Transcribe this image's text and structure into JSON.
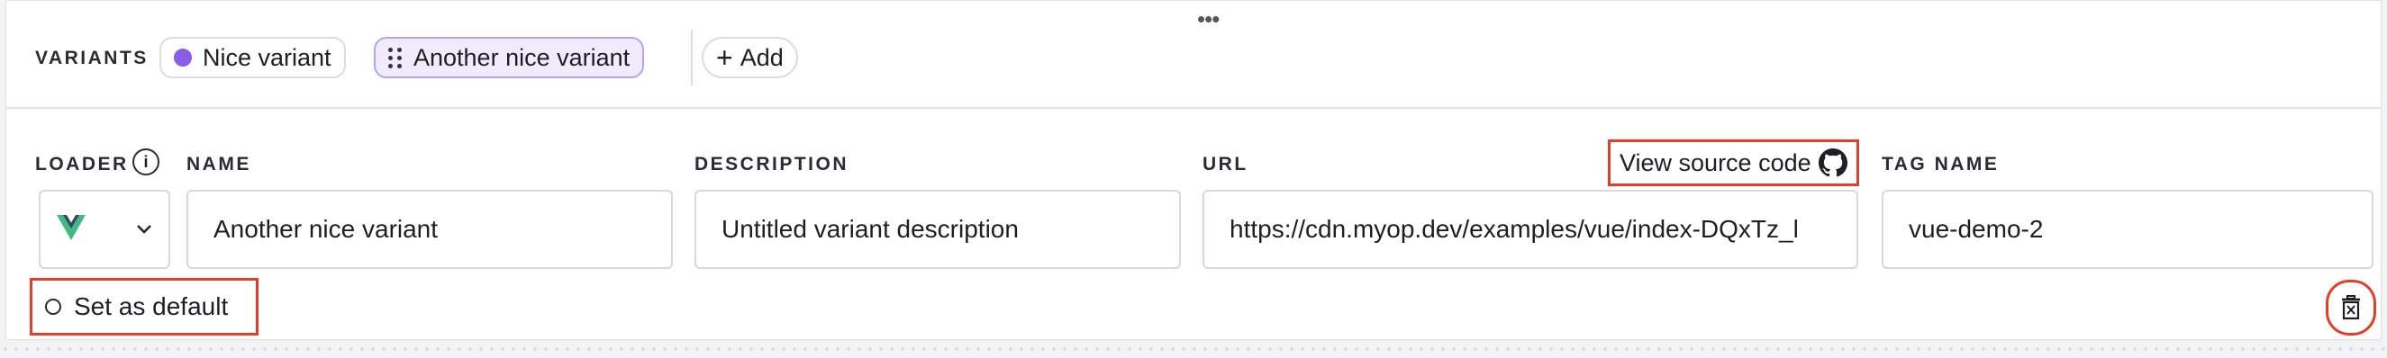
{
  "variants": {
    "label": "VARIANTS",
    "chips": [
      {
        "label": "Nice variant",
        "color": "#8a5de6"
      },
      {
        "label": "Another nice variant",
        "active": true
      }
    ],
    "add_label": "Add"
  },
  "form": {
    "loader_label": "LOADER",
    "name_label": "NAME",
    "description_label": "DESCRIPTION",
    "url_label": "URL",
    "tag_label": "TAG NAME",
    "name_value": "Another nice variant",
    "description_value": "Untitled variant description",
    "url_value": "https://cdn.myop.dev/examples/vue/index-DQxTz_l",
    "tag_value": "vue-demo-2",
    "view_source_label": "View source code",
    "set_default_label": "Set as default"
  },
  "icons": {
    "loader": "vue-logo-icon",
    "source": "github-icon",
    "delete": "trash-icon"
  },
  "colors": {
    "accent": "#8a5de6",
    "highlight": "#e0402a"
  }
}
